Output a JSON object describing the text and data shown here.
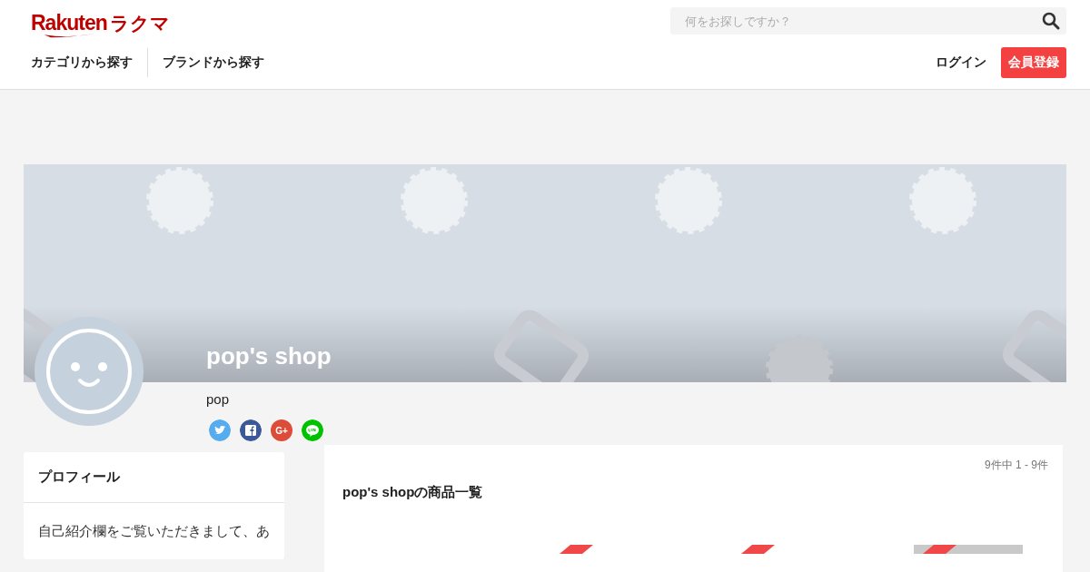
{
  "header": {
    "logo": {
      "latin": "Rakuten",
      "kana": "ラクマ"
    },
    "search": {
      "placeholder": "何をお探しですか？"
    },
    "nav": [
      {
        "label": "カテゴリから探す"
      },
      {
        "label": "ブランドから探す"
      }
    ],
    "login": "ログイン",
    "register": "会員登録"
  },
  "shop": {
    "name": "pop's shop",
    "owner": "pop",
    "share": [
      {
        "kind": "twitter"
      },
      {
        "kind": "facebook"
      },
      {
        "kind": "googleplus",
        "label": "G+"
      },
      {
        "kind": "line"
      }
    ]
  },
  "profile": {
    "title": "プロフィール",
    "text": "自己紹介欄をご覧いただきまして、あ"
  },
  "products": {
    "count": "9件中 1 - 9件",
    "title": "pop's shopの商品一覧",
    "items": [
      {
        "kind": "ribbon"
      },
      {
        "kind": "ribbon"
      },
      {
        "kind": "picture"
      }
    ]
  }
}
